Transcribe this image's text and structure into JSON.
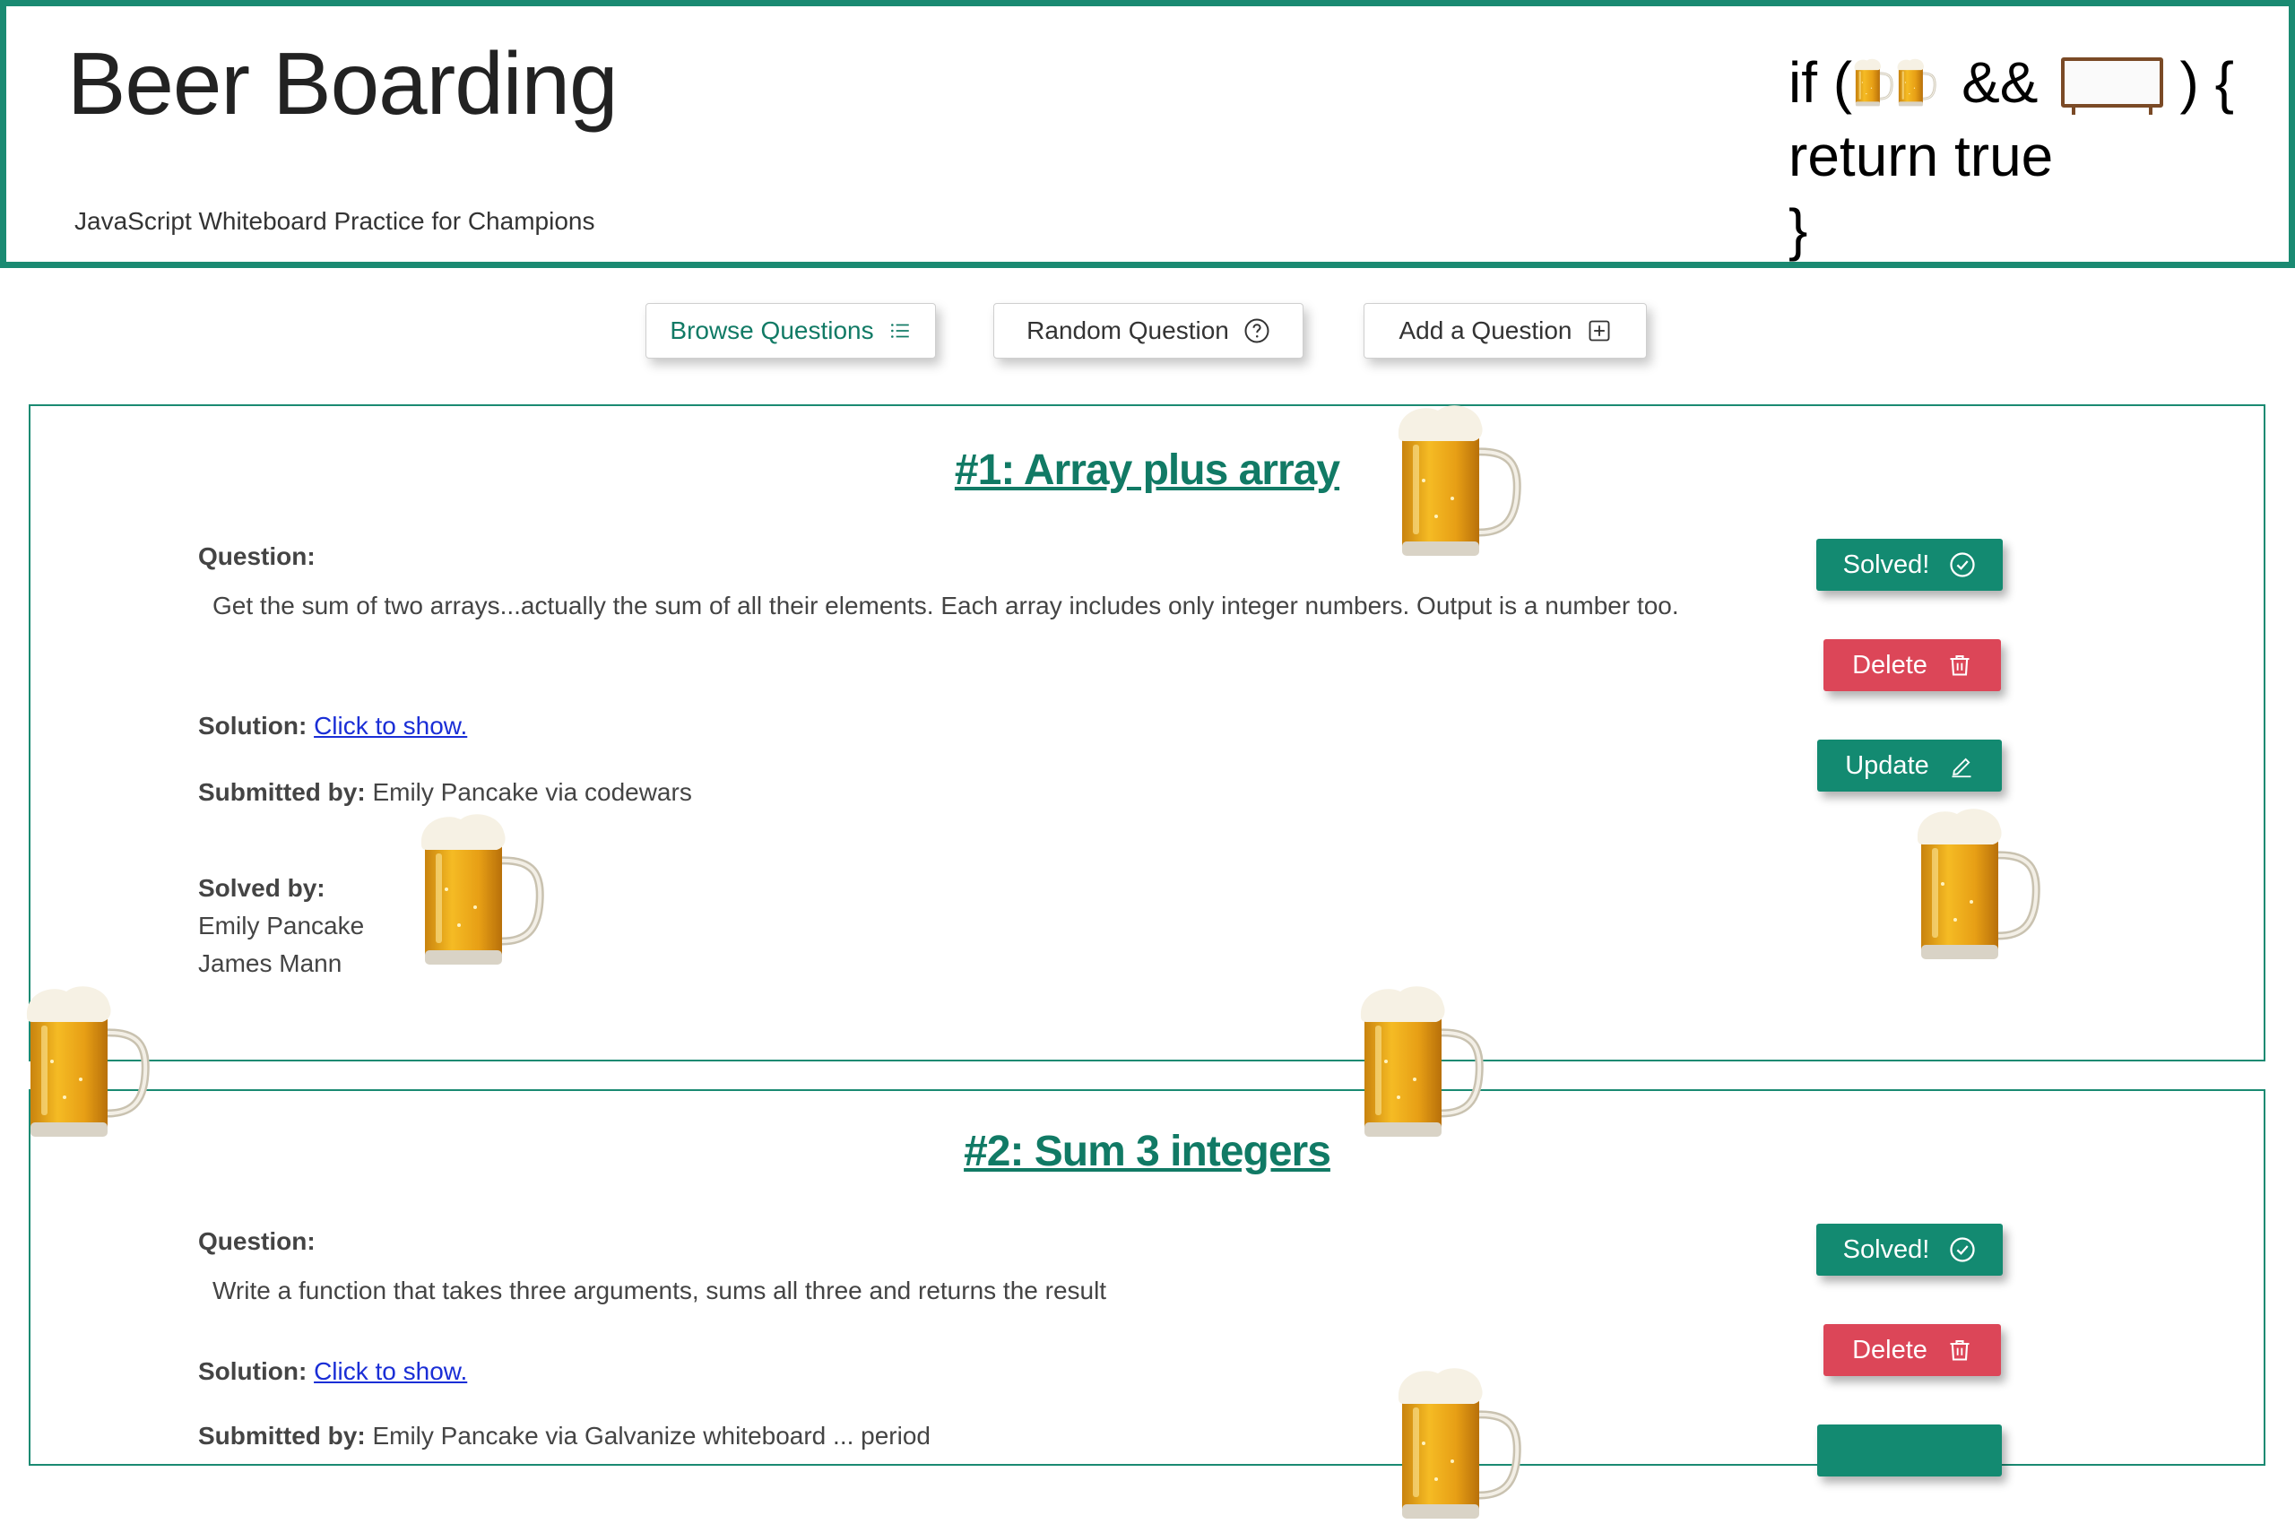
{
  "header": {
    "title": "Beer Boarding",
    "tagline": "JavaScript Whiteboard Practice for Champions",
    "code": {
      "line1_prefix": "if (",
      "line1_and": "&&",
      "line1_suffix": ") {",
      "line2": "return true",
      "line3": "}"
    }
  },
  "nav": {
    "browse": "Browse Questions",
    "random": "Random Question",
    "add": "Add a Question"
  },
  "labels": {
    "question": "Question:",
    "solution": "Solution:",
    "submitted_by": "Submitted by:",
    "solved_by": "Solved by:",
    "click_to_show": "Click to show.",
    "solved_btn": "Solved!",
    "delete_btn": "Delete",
    "update_btn": "Update"
  },
  "questions": [
    {
      "title": "#1: Array plus array",
      "text": "Get the sum of two arrays...actually the sum of all their elements. Each array includes only integer numbers. Output is a number too.",
      "submitted": "Emily Pancake via codewars",
      "solved_by": [
        "Emily Pancake",
        "James Mann"
      ]
    },
    {
      "title": "#2: Sum 3 integers",
      "text": "Write a function that takes three arguments, sums all three and returns the result",
      "submitted": "Emily Pancake via Galvanize whiteboard ... period"
    }
  ],
  "colors": {
    "brand": "#1a8a72",
    "danger": "#dc4658",
    "link": "#1a2ed6"
  }
}
